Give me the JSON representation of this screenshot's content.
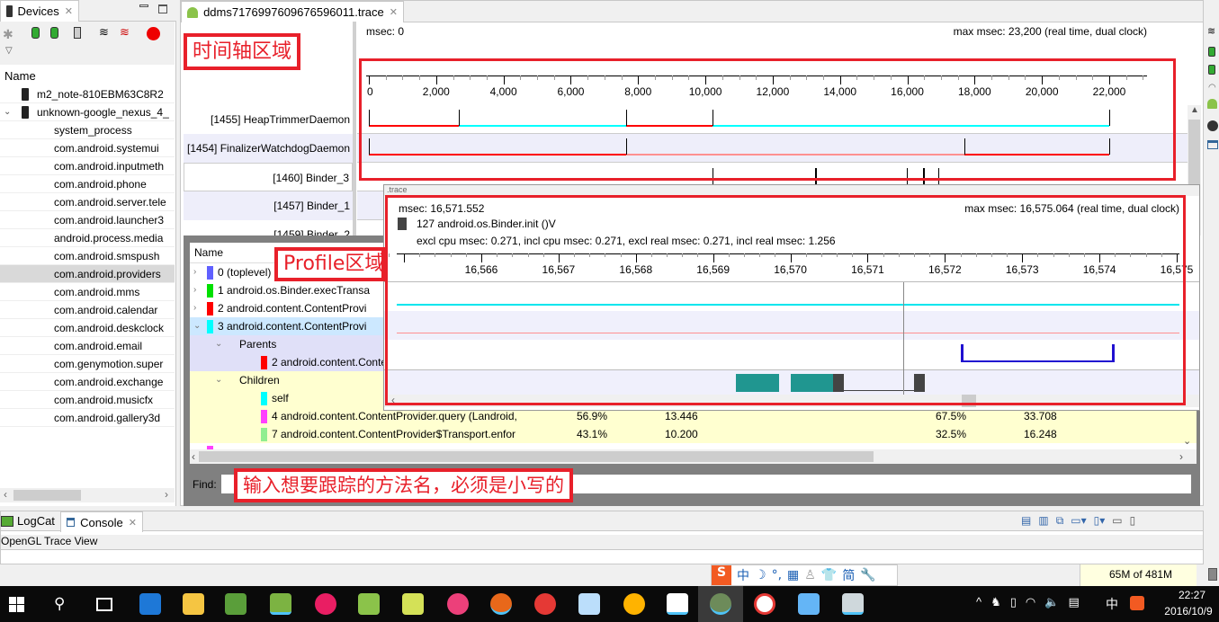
{
  "devices_panel": {
    "tab_label": "Devices",
    "column_header": "Name",
    "devices": [
      "m2_note-810EBM63C8R2",
      "unknown-google_nexus_4_"
    ],
    "processes": [
      "system_process",
      "com.android.systemui",
      "com.android.inputmeth",
      "com.android.phone",
      "com.android.server.tele",
      "com.android.launcher3",
      "android.process.media",
      "com.android.smspush",
      "com.android.providers",
      "com.android.mms",
      "com.android.calendar",
      "com.android.deskclock",
      "com.android.email",
      "com.genymotion.super",
      "com.android.exchange",
      "com.android.musicfx",
      "com.android.gallery3d"
    ],
    "selected_process": "com.android.providers"
  },
  "editor": {
    "tab_label": "ddms7176997609676596011.trace",
    "timeline": {
      "msec_label": "msec: 0",
      "max_label": "max msec: 23,200 (real time, dual clock)",
      "ticks": [
        "0",
        "2,000",
        "4,000",
        "6,000",
        "8,000",
        "10,000",
        "12,000",
        "14,000",
        "16,000",
        "18,000",
        "20,000",
        "22,000"
      ],
      "threads": [
        "[1455] HeapTrimmerDaemon",
        "[1454] FinalizerWatchdogDaemon",
        "[1460] Binder_3",
        "[1457] Binder_1",
        "[1459] Binder_2"
      ],
      "segments_ms": [
        [
          {
            "from": 0,
            "to": 2670,
            "color": "#ff0000"
          },
          {
            "from": 2670,
            "to": 7650,
            "color": "#00ffff"
          },
          {
            "from": 7650,
            "to": 10210,
            "color": "#ff0000"
          },
          {
            "from": 10210,
            "to": 22000,
            "color": "#00ffff"
          }
        ],
        [
          {
            "from": 0,
            "to": 7650,
            "color": "#ff0000"
          },
          {
            "from": 7650,
            "to": 17700,
            "color": "#ff9090"
          },
          {
            "from": 17700,
            "to": 22000,
            "color": "#ff0000"
          }
        ]
      ],
      "binder3_marks_ms": [
        10210,
        13260,
        15990,
        16470,
        16930
      ]
    },
    "zoom_view": {
      "msec_label": "msec: 16,571.552",
      "max_label": "max msec: 16,575.064 (real time, dual clock)",
      "method_label": "127 android.os.Binder.init ()V",
      "stats_label": "excl cpu msec: 0.271, incl cpu msec: 0.271, excl real msec: 0.271, incl real msec: 1.256",
      "ticks": [
        "16,566",
        "16,567",
        "16,568",
        "16,569",
        "16,570",
        "16,571",
        "16,572",
        "16,573",
        "16,574",
        "16,575"
      ],
      "cursor_ms": 16571.552
    },
    "profile": {
      "column_header": "Name",
      "rows": [
        {
          "label": "0 (toplevel)",
          "color": "#6060ff",
          "indent": 0,
          "expander": "›"
        },
        {
          "label": "1 android.os.Binder.execTransa",
          "color": "#00e000",
          "indent": 0,
          "expander": "›"
        },
        {
          "label": "2 android.content.ContentProvi",
          "color": "#ff0000",
          "indent": 0,
          "expander": "›"
        },
        {
          "label": "3 android.content.ContentProvi",
          "color": "#00ffff",
          "indent": 0,
          "expander": "⌄"
        },
        {
          "label": "Parents",
          "color": "",
          "indent": 1,
          "expander": "⌄"
        },
        {
          "label": "2 android.content.Conten",
          "color": "#ff0000",
          "indent": 2,
          "expander": ""
        },
        {
          "label": "Children",
          "color": "",
          "indent": 1,
          "expander": "⌄"
        },
        {
          "label": "self",
          "color": "#00ffff",
          "indent": 2,
          "expander": ""
        },
        {
          "label": "4 android.content.ContentProvider.query (Landroid,",
          "color": "#ff40ff",
          "indent": 2,
          "expander": "",
          "c1": "56.9%",
          "c2": "13.446",
          "c3": "67.5%",
          "c4": "33.708"
        },
        {
          "label": "7 android.content.ContentProvider$Transport.enfor",
          "color": "#90ee90",
          "indent": 2,
          "expander": "",
          "c1": "43.1%",
          "c2": "10.200",
          "c3": "32.5%",
          "c4": "16.248"
        }
      ],
      "find_label": "Find:"
    }
  },
  "annotations": {
    "timeline_area": "时间轴区域",
    "profile_area": "Profile区域",
    "find_hint": "输入想要跟踪的方法名，必须是小写的"
  },
  "bottom_panel": {
    "tabs": [
      "LogCat",
      "Console"
    ],
    "console_title": "OpenGL Trace View"
  },
  "status_bar": {
    "ime_label": "中",
    "ime_simplified": "简",
    "memory": "65M of 481M"
  },
  "taskbar": {
    "time": "22:27",
    "date": "2016/10/9",
    "input_lang": "中"
  }
}
